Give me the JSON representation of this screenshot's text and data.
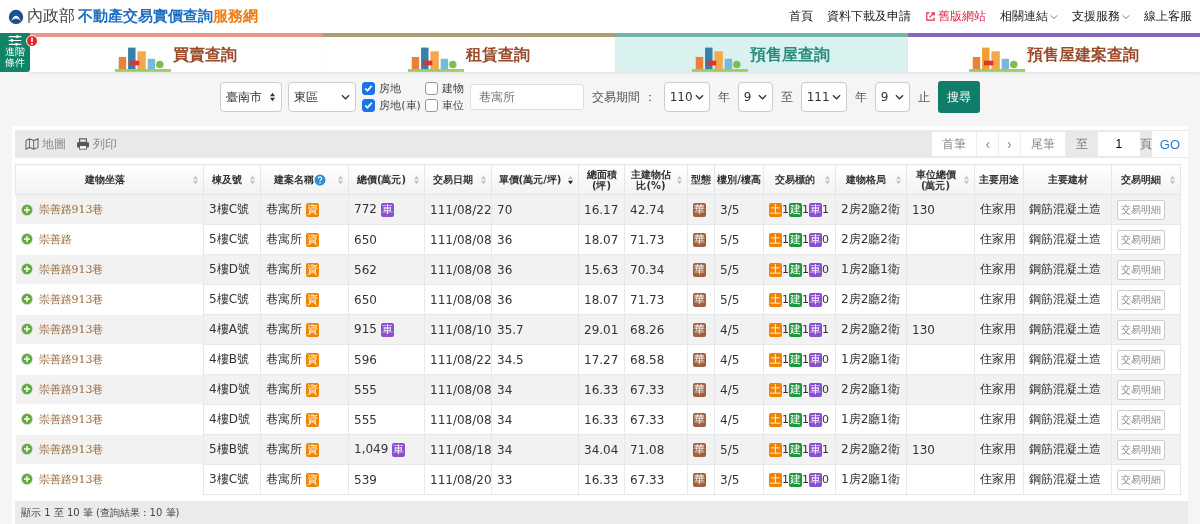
{
  "header": {
    "brand": "內政部",
    "title": "不動產交易實價查詢",
    "title_suffix": "服務網",
    "nav": [
      {
        "label": "首頁",
        "kind": "plain"
      },
      {
        "label": "資料下載及申請",
        "kind": "plain"
      },
      {
        "label": "舊版網站",
        "kind": "external"
      },
      {
        "label": "相關連結",
        "kind": "dropdown"
      },
      {
        "label": "支援服務",
        "kind": "dropdown"
      },
      {
        "label": "線上客服",
        "kind": "plain"
      }
    ]
  },
  "advanced_button": {
    "label": "進階條件"
  },
  "tabs": [
    {
      "label": "買賣查詢",
      "selected": false,
      "color": "#e8968a"
    },
    {
      "label": "租賃查詢",
      "selected": false,
      "color": "#b09a75"
    },
    {
      "label": "預售屋查詢",
      "selected": true,
      "color": "#6fb5a8"
    },
    {
      "label": "預售屋建案查詢",
      "selected": false,
      "color": "#8a64c0"
    }
  ],
  "filters": {
    "city": "臺南市",
    "district": "東區",
    "checkboxes": [
      {
        "label": "房地",
        "checked": true
      },
      {
        "label": "建物",
        "checked": false
      },
      {
        "label": "房地(車)",
        "checked": true
      },
      {
        "label": "車位",
        "checked": false
      }
    ],
    "keyword": "巷寓所",
    "period_label": "交易期間 ：",
    "from_year": "110",
    "year_unit_1": "年",
    "from_month": "9",
    "to_label": "至",
    "to_year": "111",
    "year_unit_2": "年",
    "to_month": "9",
    "end_label": "止",
    "search_button": "搜尋"
  },
  "toolbar": {
    "map": "地圖",
    "print": "列印"
  },
  "pagination": {
    "first": "首筆",
    "prev": "‹",
    "next": "›",
    "last": "尾筆",
    "goto_label": "至",
    "page": "1",
    "page_unit": "頁",
    "go": "GO"
  },
  "table": {
    "columns": [
      {
        "label": "建物坐落",
        "sortable": true,
        "sorted": false,
        "help": false
      },
      {
        "label": "棟及號",
        "sortable": true,
        "sorted": false,
        "help": false
      },
      {
        "label": "建案名稱",
        "sortable": true,
        "sorted": false,
        "help": true
      },
      {
        "label": "總價(萬元)",
        "sortable": true,
        "sorted": false,
        "help": false
      },
      {
        "label": "交易日期",
        "sortable": true,
        "sorted": false,
        "help": false
      },
      {
        "label": "單價(萬元/坪)",
        "sortable": true,
        "sorted": true,
        "help": false
      },
      {
        "label": "總面積(坪)",
        "sortable": false,
        "help": false
      },
      {
        "label": "主建物佔比(%)",
        "sortable": true,
        "sorted": false,
        "help": false
      },
      {
        "label": "型態",
        "sortable": false,
        "help": false
      },
      {
        "label": "樓別/樓高",
        "sortable": false,
        "help": false
      },
      {
        "label": "交易標的",
        "sortable": true,
        "sorted": false,
        "help": false
      },
      {
        "label": "建物格局",
        "sortable": true,
        "sorted": false,
        "help": false
      },
      {
        "label": "車位總價(萬元)",
        "sortable": true,
        "sorted": false,
        "help": false
      },
      {
        "label": "主要用途",
        "sortable": false,
        "help": false
      },
      {
        "label": "主要建材",
        "sortable": false,
        "help": false
      },
      {
        "label": "交易明細",
        "sortable": true,
        "sorted": false,
        "help": false
      }
    ],
    "rows": [
      {
        "address": "崇善路913巷",
        "unit": "3樓C號",
        "project": "巷寓所",
        "project_badge": "資",
        "price": "772",
        "price_badge": "車",
        "date": "111/08/22",
        "unit_price": "70",
        "area": "16.17",
        "main_ratio": "42.74",
        "type": "華",
        "floor": "3/5",
        "targets": [
          {
            "label": "土",
            "count": "1",
            "color": "#f08300"
          },
          {
            "label": "建",
            "count": "1",
            "color": "#1a9a3a"
          },
          {
            "label": "車",
            "count": "1",
            "color": "#8a4fd0"
          }
        ],
        "layout": "2房2廳2衛",
        "parking_price": "130",
        "usage": "住家用",
        "material": "鋼筋混凝土造",
        "detail": "交易明細"
      },
      {
        "address": "崇善路",
        "unit": "5樓C號",
        "project": "巷寓所",
        "project_badge": "資",
        "price": "650",
        "price_badge": "",
        "date": "111/08/08",
        "unit_price": "36",
        "area": "18.07",
        "main_ratio": "71.73",
        "type": "華",
        "floor": "5/5",
        "targets": [
          {
            "label": "土",
            "count": "1",
            "color": "#f08300"
          },
          {
            "label": "建",
            "count": "1",
            "color": "#1a9a3a"
          },
          {
            "label": "車",
            "count": "0",
            "color": "#8a4fd0"
          }
        ],
        "layout": "2房2廳2衛",
        "parking_price": "",
        "usage": "住家用",
        "material": "鋼筋混凝土造",
        "detail": "交易明細"
      },
      {
        "address": "崇善路913巷",
        "unit": "5樓D號",
        "project": "巷寓所",
        "project_badge": "資",
        "price": "562",
        "price_badge": "",
        "date": "111/08/08",
        "unit_price": "36",
        "area": "15.63",
        "main_ratio": "70.34",
        "type": "華",
        "floor": "5/5",
        "targets": [
          {
            "label": "土",
            "count": "1",
            "color": "#f08300"
          },
          {
            "label": "建",
            "count": "1",
            "color": "#1a9a3a"
          },
          {
            "label": "車",
            "count": "0",
            "color": "#8a4fd0"
          }
        ],
        "layout": "1房2廳1衛",
        "parking_price": "",
        "usage": "住家用",
        "material": "鋼筋混凝土造",
        "detail": "交易明細"
      },
      {
        "address": "崇善路913巷",
        "unit": "5樓C號",
        "project": "巷寓所",
        "project_badge": "資",
        "price": "650",
        "price_badge": "",
        "date": "111/08/08",
        "unit_price": "36",
        "area": "18.07",
        "main_ratio": "71.73",
        "type": "華",
        "floor": "5/5",
        "targets": [
          {
            "label": "土",
            "count": "1",
            "color": "#f08300"
          },
          {
            "label": "建",
            "count": "1",
            "color": "#1a9a3a"
          },
          {
            "label": "車",
            "count": "0",
            "color": "#8a4fd0"
          }
        ],
        "layout": "2房2廳2衛",
        "parking_price": "",
        "usage": "住家用",
        "material": "鋼筋混凝土造",
        "detail": "交易明細"
      },
      {
        "address": "崇善路913巷",
        "unit": "4樓A號",
        "project": "巷寓所",
        "project_badge": "資",
        "price": "915",
        "price_badge": "車",
        "date": "111/08/10",
        "unit_price": "35.7",
        "area": "29.01",
        "main_ratio": "68.26",
        "type": "華",
        "floor": "4/5",
        "targets": [
          {
            "label": "土",
            "count": "1",
            "color": "#f08300"
          },
          {
            "label": "建",
            "count": "1",
            "color": "#1a9a3a"
          },
          {
            "label": "車",
            "count": "1",
            "color": "#8a4fd0"
          }
        ],
        "layout": "2房2廳2衛",
        "parking_price": "130",
        "usage": "住家用",
        "material": "鋼筋混凝土造",
        "detail": "交易明細"
      },
      {
        "address": "崇善路913巷",
        "unit": "4樓B號",
        "project": "巷寓所",
        "project_badge": "資",
        "price": "596",
        "price_badge": "",
        "date": "111/08/22",
        "unit_price": "34.5",
        "area": "17.27",
        "main_ratio": "68.58",
        "type": "華",
        "floor": "4/5",
        "targets": [
          {
            "label": "土",
            "count": "1",
            "color": "#f08300"
          },
          {
            "label": "建",
            "count": "1",
            "color": "#1a9a3a"
          },
          {
            "label": "車",
            "count": "0",
            "color": "#8a4fd0"
          }
        ],
        "layout": "1房2廳1衛",
        "parking_price": "",
        "usage": "住家用",
        "material": "鋼筋混凝土造",
        "detail": "交易明細"
      },
      {
        "address": "崇善路913巷",
        "unit": "4樓D號",
        "project": "巷寓所",
        "project_badge": "資",
        "price": "555",
        "price_badge": "",
        "date": "111/08/08",
        "unit_price": "34",
        "area": "16.33",
        "main_ratio": "67.33",
        "type": "華",
        "floor": "4/5",
        "targets": [
          {
            "label": "土",
            "count": "1",
            "color": "#f08300"
          },
          {
            "label": "建",
            "count": "1",
            "color": "#1a9a3a"
          },
          {
            "label": "車",
            "count": "0",
            "color": "#8a4fd0"
          }
        ],
        "layout": "2房2廳1衛",
        "parking_price": "",
        "usage": "住家用",
        "material": "鋼筋混凝土造",
        "detail": "交易明細"
      },
      {
        "address": "崇善路913巷",
        "unit": "4樓D號",
        "project": "巷寓所",
        "project_badge": "資",
        "price": "555",
        "price_badge": "",
        "date": "111/08/08",
        "unit_price": "34",
        "area": "16.33",
        "main_ratio": "67.33",
        "type": "華",
        "floor": "4/5",
        "targets": [
          {
            "label": "土",
            "count": "1",
            "color": "#f08300"
          },
          {
            "label": "建",
            "count": "1",
            "color": "#1a9a3a"
          },
          {
            "label": "車",
            "count": "0",
            "color": "#8a4fd0"
          }
        ],
        "layout": "1房2廳1衛",
        "parking_price": "",
        "usage": "住家用",
        "material": "鋼筋混凝土造",
        "detail": "交易明細"
      },
      {
        "address": "崇善路913巷",
        "unit": "5樓B號",
        "project": "巷寓所",
        "project_badge": "資",
        "price": "1,049",
        "price_badge": "車",
        "date": "111/08/18",
        "unit_price": "34",
        "area": "34.04",
        "main_ratio": "71.08",
        "type": "華",
        "floor": "5/5",
        "targets": [
          {
            "label": "土",
            "count": "1",
            "color": "#f08300"
          },
          {
            "label": "建",
            "count": "1",
            "color": "#1a9a3a"
          },
          {
            "label": "車",
            "count": "1",
            "color": "#8a4fd0"
          }
        ],
        "layout": "2房2廳2衛",
        "parking_price": "130",
        "usage": "住家用",
        "material": "鋼筋混凝土造",
        "detail": "交易明細"
      },
      {
        "address": "崇善路913巷",
        "unit": "3樓C號",
        "project": "巷寓所",
        "project_badge": "資",
        "price": "539",
        "price_badge": "",
        "date": "111/08/20",
        "unit_price": "33",
        "area": "16.33",
        "main_ratio": "67.33",
        "type": "華",
        "floor": "3/5",
        "targets": [
          {
            "label": "土",
            "count": "1",
            "color": "#f08300"
          },
          {
            "label": "建",
            "count": "1",
            "color": "#1a9a3a"
          },
          {
            "label": "車",
            "count": "0",
            "color": "#8a4fd0"
          }
        ],
        "layout": "1房2廳1衛",
        "parking_price": "",
        "usage": "住家用",
        "material": "鋼筋混凝土造",
        "detail": "交易明細"
      }
    ]
  },
  "status_bar": "顯示 1 至 10 筆 (查詢結果 : 10 筆)"
}
